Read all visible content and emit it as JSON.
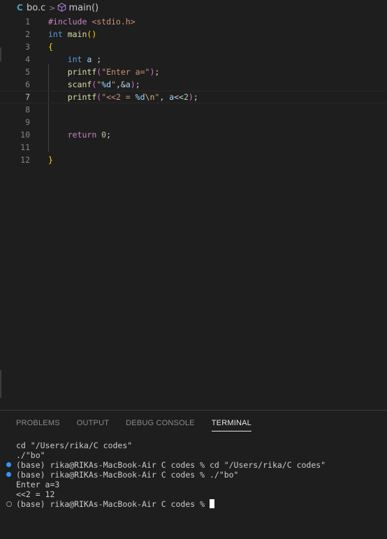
{
  "breadcrumb": {
    "file_icon": "C",
    "file": "bo.c",
    "separator": ">",
    "symbol_icon": "cube-icon",
    "symbol": "main()"
  },
  "editor": {
    "current_line": 7,
    "lines": [
      {
        "n": "1",
        "tokens": [
          [
            "pp",
            "#include "
          ],
          [
            "inc",
            "<stdio.h>"
          ]
        ]
      },
      {
        "n": "2",
        "tokens": [
          [
            "kw",
            "int "
          ],
          [
            "fn",
            "main"
          ],
          [
            "br1",
            "()"
          ]
        ]
      },
      {
        "n": "3",
        "tokens": [
          [
            "br1",
            "{"
          ]
        ]
      },
      {
        "n": "4",
        "tokens": [
          [
            "pun",
            "    "
          ],
          [
            "kw",
            "int "
          ],
          [
            "var",
            "a"
          ],
          [
            "pun",
            " ;"
          ]
        ]
      },
      {
        "n": "5",
        "tokens": [
          [
            "pun",
            "    "
          ],
          [
            "fn",
            "printf"
          ],
          [
            "br2",
            "("
          ],
          [
            "str",
            "\"Enter a=\""
          ],
          [
            "br2",
            ")"
          ],
          [
            "pun",
            ";"
          ]
        ]
      },
      {
        "n": "6",
        "tokens": [
          [
            "pun",
            "    "
          ],
          [
            "fn",
            "scanf"
          ],
          [
            "br2",
            "("
          ],
          [
            "str",
            "\""
          ],
          [
            "fmt",
            "%d"
          ],
          [
            "str",
            "\""
          ],
          [
            "pun",
            ",&"
          ],
          [
            "var",
            "a"
          ],
          [
            "br2",
            ")"
          ],
          [
            "pun",
            ";"
          ]
        ]
      },
      {
        "n": "7",
        "tokens": [
          [
            "pun",
            "    "
          ],
          [
            "fn",
            "printf"
          ],
          [
            "br2",
            "("
          ],
          [
            "str",
            "\"<<2 = "
          ],
          [
            "fmt",
            "%d"
          ],
          [
            "esc",
            "\\n"
          ],
          [
            "str",
            "\""
          ],
          [
            "pun",
            ", "
          ],
          [
            "var",
            "a"
          ],
          [
            "pun",
            "<<"
          ],
          [
            "num",
            "2"
          ],
          [
            "br2",
            ")"
          ],
          [
            "pun",
            ";"
          ]
        ]
      },
      {
        "n": "8",
        "tokens": []
      },
      {
        "n": "9",
        "tokens": []
      },
      {
        "n": "10",
        "tokens": [
          [
            "pun",
            "    "
          ],
          [
            "ctl",
            "return "
          ],
          [
            "num",
            "0"
          ],
          [
            "pun",
            ";"
          ]
        ]
      },
      {
        "n": "11",
        "tokens": []
      },
      {
        "n": "12",
        "tokens": [
          [
            "br1",
            "}"
          ]
        ]
      }
    ]
  },
  "panel": {
    "tabs": [
      {
        "label": "PROBLEMS",
        "active": false
      },
      {
        "label": "OUTPUT",
        "active": false
      },
      {
        "label": "DEBUG CONSOLE",
        "active": false
      },
      {
        "label": "TERMINAL",
        "active": true
      }
    ]
  },
  "terminal": {
    "lines": [
      {
        "text": "cd \"/Users/rika/C codes\"",
        "marker": "none"
      },
      {
        "text": "./\"bo\"",
        "marker": "none"
      },
      {
        "text": "(base) rika@RIKAs-MacBook-Air C codes % cd \"/Users/rika/C codes\"",
        "marker": "filled"
      },
      {
        "text": "(base) rika@RIKAs-MacBook-Air C codes % ./\"bo\"",
        "marker": "filled"
      },
      {
        "text": "Enter a=3",
        "marker": "none"
      },
      {
        "text": "<<2 = 12",
        "marker": "none"
      },
      {
        "text": "(base) rika@RIKAs-MacBook-Air C codes % ",
        "marker": "hollow",
        "cursor": true
      }
    ]
  },
  "colors": {
    "background": "#1e1e1e",
    "decoration_blue": "#3794ff",
    "keyword": "#569cd6",
    "function": "#dcdcaa",
    "string": "#ce9178"
  }
}
